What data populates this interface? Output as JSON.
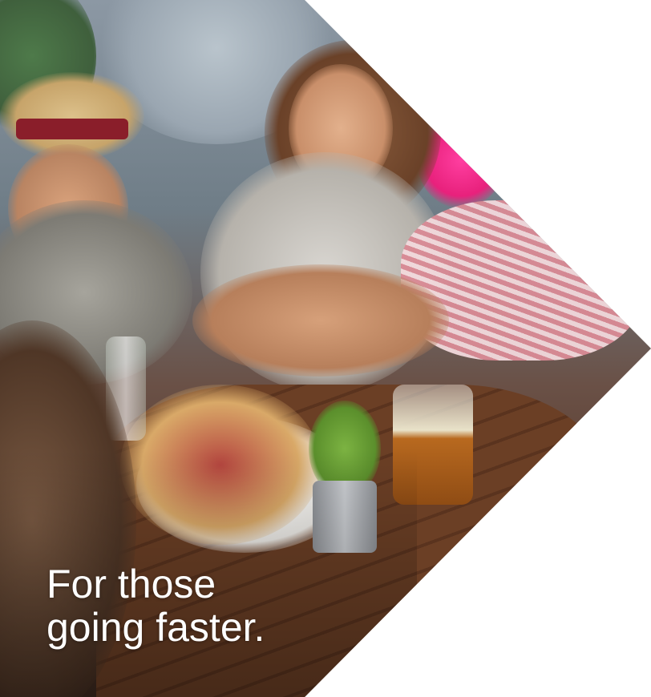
{
  "hero": {
    "tagline_line1": "For those",
    "tagline_line2": "going faster."
  },
  "colors": {
    "background": "#ffffff",
    "tagline_text": "#ffffff",
    "accent_pink": "#e8217c"
  }
}
